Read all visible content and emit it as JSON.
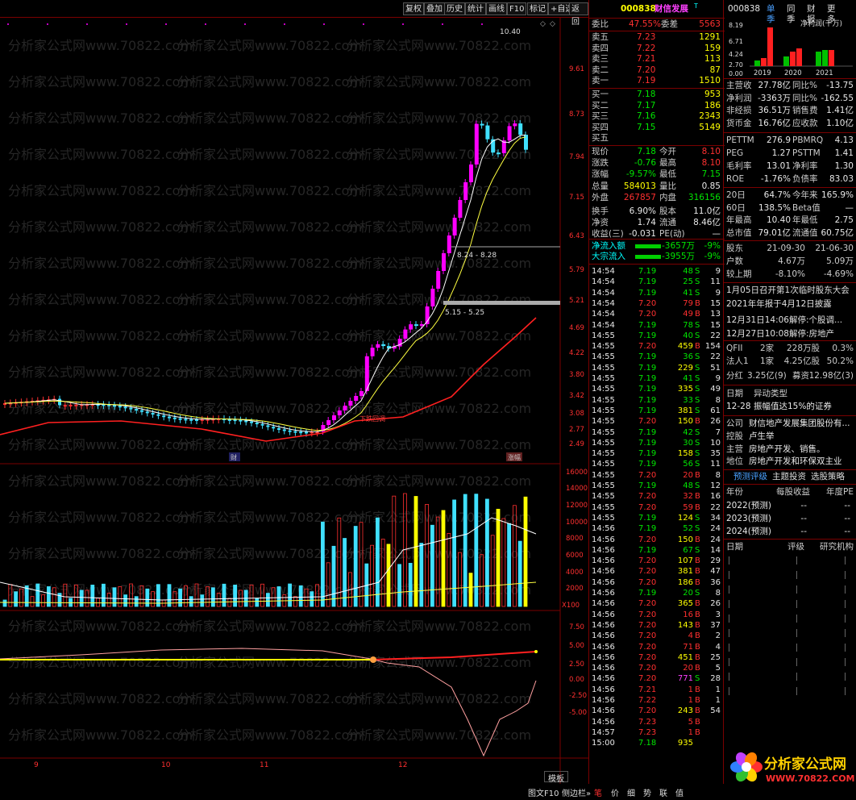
{
  "toolbar": {
    "items": [
      "复权",
      "叠加",
      "历史",
      "统计",
      "画线",
      "F10",
      "标记",
      "+自选",
      "返回"
    ]
  },
  "chart": {
    "price_labels": [
      "9.61",
      "8.73",
      "7.94",
      "7.15",
      "6.43",
      "5.79",
      "5.21",
      "4.69",
      "4.22",
      "3.80",
      "3.42",
      "3.08",
      "2.77",
      "2.49"
    ],
    "vol_labels": [
      "16000",
      "14000",
      "12000",
      "10000",
      "8000",
      "6000",
      "4000",
      "2000",
      "X100"
    ],
    "osc_labels": [
      "7.50",
      "5.00",
      "2.50",
      "0.00",
      "-2.50",
      "-5.00"
    ],
    "month_labels": [
      "9",
      "10",
      "11",
      "12"
    ],
    "annotations": {
      "high": "10.40",
      "a1": "8.24 - 8.28",
      "a2": "5.15 - 5.25",
      "tag1": "财",
      "tag2": "涨幅",
      "tag3": "下跌回调"
    },
    "watermark": "分析家公式网www.70822.com",
    "bottom_tabs": [
      "模板",
      "日线"
    ],
    "bottom_tabs2": [
      "图文F10",
      "侧边栏»",
      "笔",
      "价",
      "细",
      "势",
      "联",
      "值"
    ]
  },
  "quote": {
    "code": "000838",
    "name": "财信发展",
    "name_sup": "T",
    "weibi_label": "委比",
    "weibi": "47.55%",
    "weicha_label": "委差",
    "weicha": "5563",
    "asks": [
      {
        "l": "卖五",
        "p": "7.23",
        "v": "1291"
      },
      {
        "l": "卖四",
        "p": "7.22",
        "v": "159"
      },
      {
        "l": "卖三",
        "p": "7.21",
        "v": "113"
      },
      {
        "l": "卖二",
        "p": "7.20",
        "v": "87"
      },
      {
        "l": "卖一",
        "p": "7.19",
        "v": "1510"
      }
    ],
    "bids": [
      {
        "l": "买一",
        "p": "7.18",
        "v": "953"
      },
      {
        "l": "买二",
        "p": "7.17",
        "v": "186"
      },
      {
        "l": "买三",
        "p": "7.16",
        "v": "2343"
      },
      {
        "l": "买四",
        "p": "7.15",
        "v": "5149"
      },
      {
        "l": "买五",
        "p": "",
        "v": ""
      }
    ],
    "stats": [
      {
        "l1": "现价",
        "v1": "7.18",
        "l2": "今开",
        "v2": "8.10"
      },
      {
        "l1": "涨跌",
        "v1": "-0.76",
        "l2": "最高",
        "v2": "8.10"
      },
      {
        "l1": "涨幅",
        "v1": "-9.57%",
        "l2": "最低",
        "v2": "7.15"
      },
      {
        "l1": "总量",
        "v1": "584013",
        "l2": "量比",
        "v2": "0.85"
      },
      {
        "l1": "外盘",
        "v1": "267857",
        "l2": "内盘",
        "v2": "316156"
      },
      {
        "l1": "换手",
        "v1": "6.90%",
        "l2": "股本",
        "v2": "11.0亿"
      },
      {
        "l1": "净资",
        "v1": "1.74",
        "l2": "流通",
        "v2": "8.46亿"
      },
      {
        "l1": "收益(三)",
        "v1": "-0.031",
        "l2": "PE(动)",
        "v2": "—"
      }
    ],
    "flow": [
      {
        "l": "净流入额",
        "v": "-3657万",
        "p": "-9%"
      },
      {
        "l": "大宗流入",
        "v": "-3955万",
        "p": "-9%"
      }
    ],
    "tape": [
      [
        "14:54",
        "7.19",
        "48",
        "S",
        "9"
      ],
      [
        "14:54",
        "7.19",
        "25",
        "S",
        "11"
      ],
      [
        "14:54",
        "7.19",
        "41",
        "S",
        "9"
      ],
      [
        "14:54",
        "7.20",
        "79",
        "B",
        "15"
      ],
      [
        "14:54",
        "7.20",
        "49",
        "B",
        "13"
      ],
      [
        "14:54",
        "7.19",
        "78",
        "S",
        "15"
      ],
      [
        "14:55",
        "7.19",
        "40",
        "S",
        "22"
      ],
      [
        "14:55",
        "7.20",
        "459",
        "B",
        "154"
      ],
      [
        "14:55",
        "7.19",
        "36",
        "S",
        "22"
      ],
      [
        "14:55",
        "7.19",
        "229",
        "S",
        "51"
      ],
      [
        "14:55",
        "7.19",
        "41",
        "S",
        "9"
      ],
      [
        "14:55",
        "7.19",
        "335",
        "S",
        "49"
      ],
      [
        "14:55",
        "7.19",
        "33",
        "S",
        "8"
      ],
      [
        "14:55",
        "7.19",
        "381",
        "S",
        "61"
      ],
      [
        "14:55",
        "7.20",
        "150",
        "B",
        "26"
      ],
      [
        "14:55",
        "7.19",
        "42",
        "S",
        "7"
      ],
      [
        "14:55",
        "7.19",
        "30",
        "S",
        "10"
      ],
      [
        "14:55",
        "7.19",
        "158",
        "S",
        "35"
      ],
      [
        "14:55",
        "7.19",
        "56",
        "S",
        "11"
      ],
      [
        "14:55",
        "7.20",
        "20",
        "B",
        "8"
      ],
      [
        "14:55",
        "7.19",
        "48",
        "S",
        "12"
      ],
      [
        "14:55",
        "7.20",
        "32",
        "B",
        "16"
      ],
      [
        "14:55",
        "7.20",
        "59",
        "B",
        "22"
      ],
      [
        "14:55",
        "7.19",
        "124",
        "S",
        "34"
      ],
      [
        "14:56",
        "7.19",
        "52",
        "S",
        "24"
      ],
      [
        "14:56",
        "7.20",
        "150",
        "B",
        "24"
      ],
      [
        "14:56",
        "7.19",
        "67",
        "S",
        "14"
      ],
      [
        "14:56",
        "7.20",
        "107",
        "B",
        "29"
      ],
      [
        "14:56",
        "7.20",
        "381",
        "B",
        "47"
      ],
      [
        "14:56",
        "7.20",
        "186",
        "B",
        "36"
      ],
      [
        "14:56",
        "7.19",
        "20",
        "S",
        "8"
      ],
      [
        "14:56",
        "7.20",
        "365",
        "B",
        "26"
      ],
      [
        "14:56",
        "7.20",
        "16",
        "B",
        "3"
      ],
      [
        "14:56",
        "7.20",
        "143",
        "B",
        "37"
      ],
      [
        "14:56",
        "7.20",
        "4",
        "B",
        "2"
      ],
      [
        "14:56",
        "7.20",
        "71",
        "B",
        "4"
      ],
      [
        "14:56",
        "7.20",
        "451",
        "B",
        "25"
      ],
      [
        "14:56",
        "7.20",
        "20",
        "B",
        "5"
      ],
      [
        "14:56",
        "7.20",
        "771",
        "S",
        "28"
      ],
      [
        "14:56",
        "7.21",
        "1",
        "B",
        "1"
      ],
      [
        "14:56",
        "7.22",
        "1",
        "B",
        "1"
      ],
      [
        "14:56",
        "7.20",
        "243",
        "B",
        "54"
      ],
      [
        "14:56",
        "7.23",
        "5",
        "B",
        ""
      ],
      [
        "14:57",
        "7.23",
        "1",
        "B",
        ""
      ],
      [
        "15:00",
        "7.18",
        "935",
        "",
        ""
      ]
    ]
  },
  "side": {
    "code": "000838",
    "tabs": [
      "单季",
      "同季",
      "财报",
      "更多"
    ],
    "chart_title": "净利润(千万)",
    "years": [
      "2019",
      "2020",
      "2021"
    ],
    "y_ticks": [
      "8.19",
      "6.71",
      "4.24",
      "2.70",
      "0.00"
    ],
    "fin": [
      {
        "l1": "主营收",
        "v1": "27.78亿",
        "l2": "同比%",
        "v2": "-13.75"
      },
      {
        "l1": "净利润",
        "v1": "-3363万",
        "l2": "同比%",
        "v2": "-162.55"
      },
      {
        "l1": "非经损",
        "v1": "36.51万",
        "l2": "销售费",
        "v2": "1.41亿"
      },
      {
        "l1": "货币金",
        "v1": "16.76亿",
        "l2": "应收款",
        "v2": "1.10亿"
      }
    ],
    "val": [
      {
        "l1": "PETTM",
        "v1": "276.9",
        "l2": "PBMRQ",
        "v2": "4.13"
      },
      {
        "l1": "PEG",
        "v1": "1.27",
        "l2": "PSTTM",
        "v2": "1.41"
      },
      {
        "l1": "毛利率",
        "v1": "13.01",
        "l2": "净利率",
        "v2": "1.30"
      },
      {
        "l1": "ROE",
        "v1": "-1.76%",
        "l2": "负债率",
        "v2": "83.03"
      }
    ],
    "perf": [
      {
        "l1": "20日",
        "v1": "64.7%",
        "l2": "今年来",
        "v2": "165.9%"
      },
      {
        "l1": "60日",
        "v1": "138.5%",
        "l2": "Beta值",
        "v2": "—"
      },
      {
        "l1": "年最高",
        "v1": "10.40",
        "l2": "年最低",
        "v2": "2.75"
      },
      {
        "l1": "总市值",
        "v1": "79.01亿",
        "l2": "流通值",
        "v2": "60.75亿"
      }
    ],
    "holders": {
      "h": [
        "股东",
        "21-09-30",
        "21-06-30"
      ],
      "r1": [
        "户数",
        "4.67万",
        "5.09万"
      ],
      "r2": [
        "较上期",
        "-8.10%",
        "-4.69%"
      ]
    },
    "news": [
      "1月05日召开第1次临时股东大会",
      "2021年年报于4月12日披露",
      "12月31日14:06解停:个股调...",
      "12月27日10:08解停:房地产"
    ],
    "inst": [
      {
        "l": "QFII",
        "a": "2家",
        "b": "228万股",
        "c": "0.3%"
      },
      {
        "l": "法人1",
        "a": "1家",
        "b": "4.25亿股",
        "c": "50.2%"
      }
    ],
    "div": {
      "l": "分红",
      "v": "3.25亿(9)",
      "l2": "募资",
      "v2": "12.98亿(3)"
    },
    "anom": {
      "h1": "日期",
      "h2": "异动类型",
      "d": "12-28",
      "t": "振幅值达15%的证券"
    },
    "company": [
      {
        "l": "公司",
        "v": "财信地产发展集团股份有..."
      },
      {
        "l": "控股",
        "v": "卢生举"
      },
      {
        "l": "主营",
        "v": "房地产开发、销售。"
      },
      {
        "l": "地位",
        "v": "房地产开发和环保双主业"
      }
    ],
    "tabs2": [
      "预测评级",
      "主题投资",
      "选股策略"
    ],
    "forecast": {
      "h": [
        "年份",
        "每股收益",
        "年度PE"
      ],
      "rows": [
        [
          "2022(预测)",
          "--",
          "--"
        ],
        [
          "2023(预测)",
          "--",
          "--"
        ],
        [
          "2024(预测)",
          "--",
          "--"
        ]
      ]
    },
    "rating": {
      "h": [
        "日期",
        "评级",
        "研究机构"
      ]
    },
    "logo": {
      "name": "分析家公式网",
      "url": "WWW.70822.COM"
    }
  }
}
